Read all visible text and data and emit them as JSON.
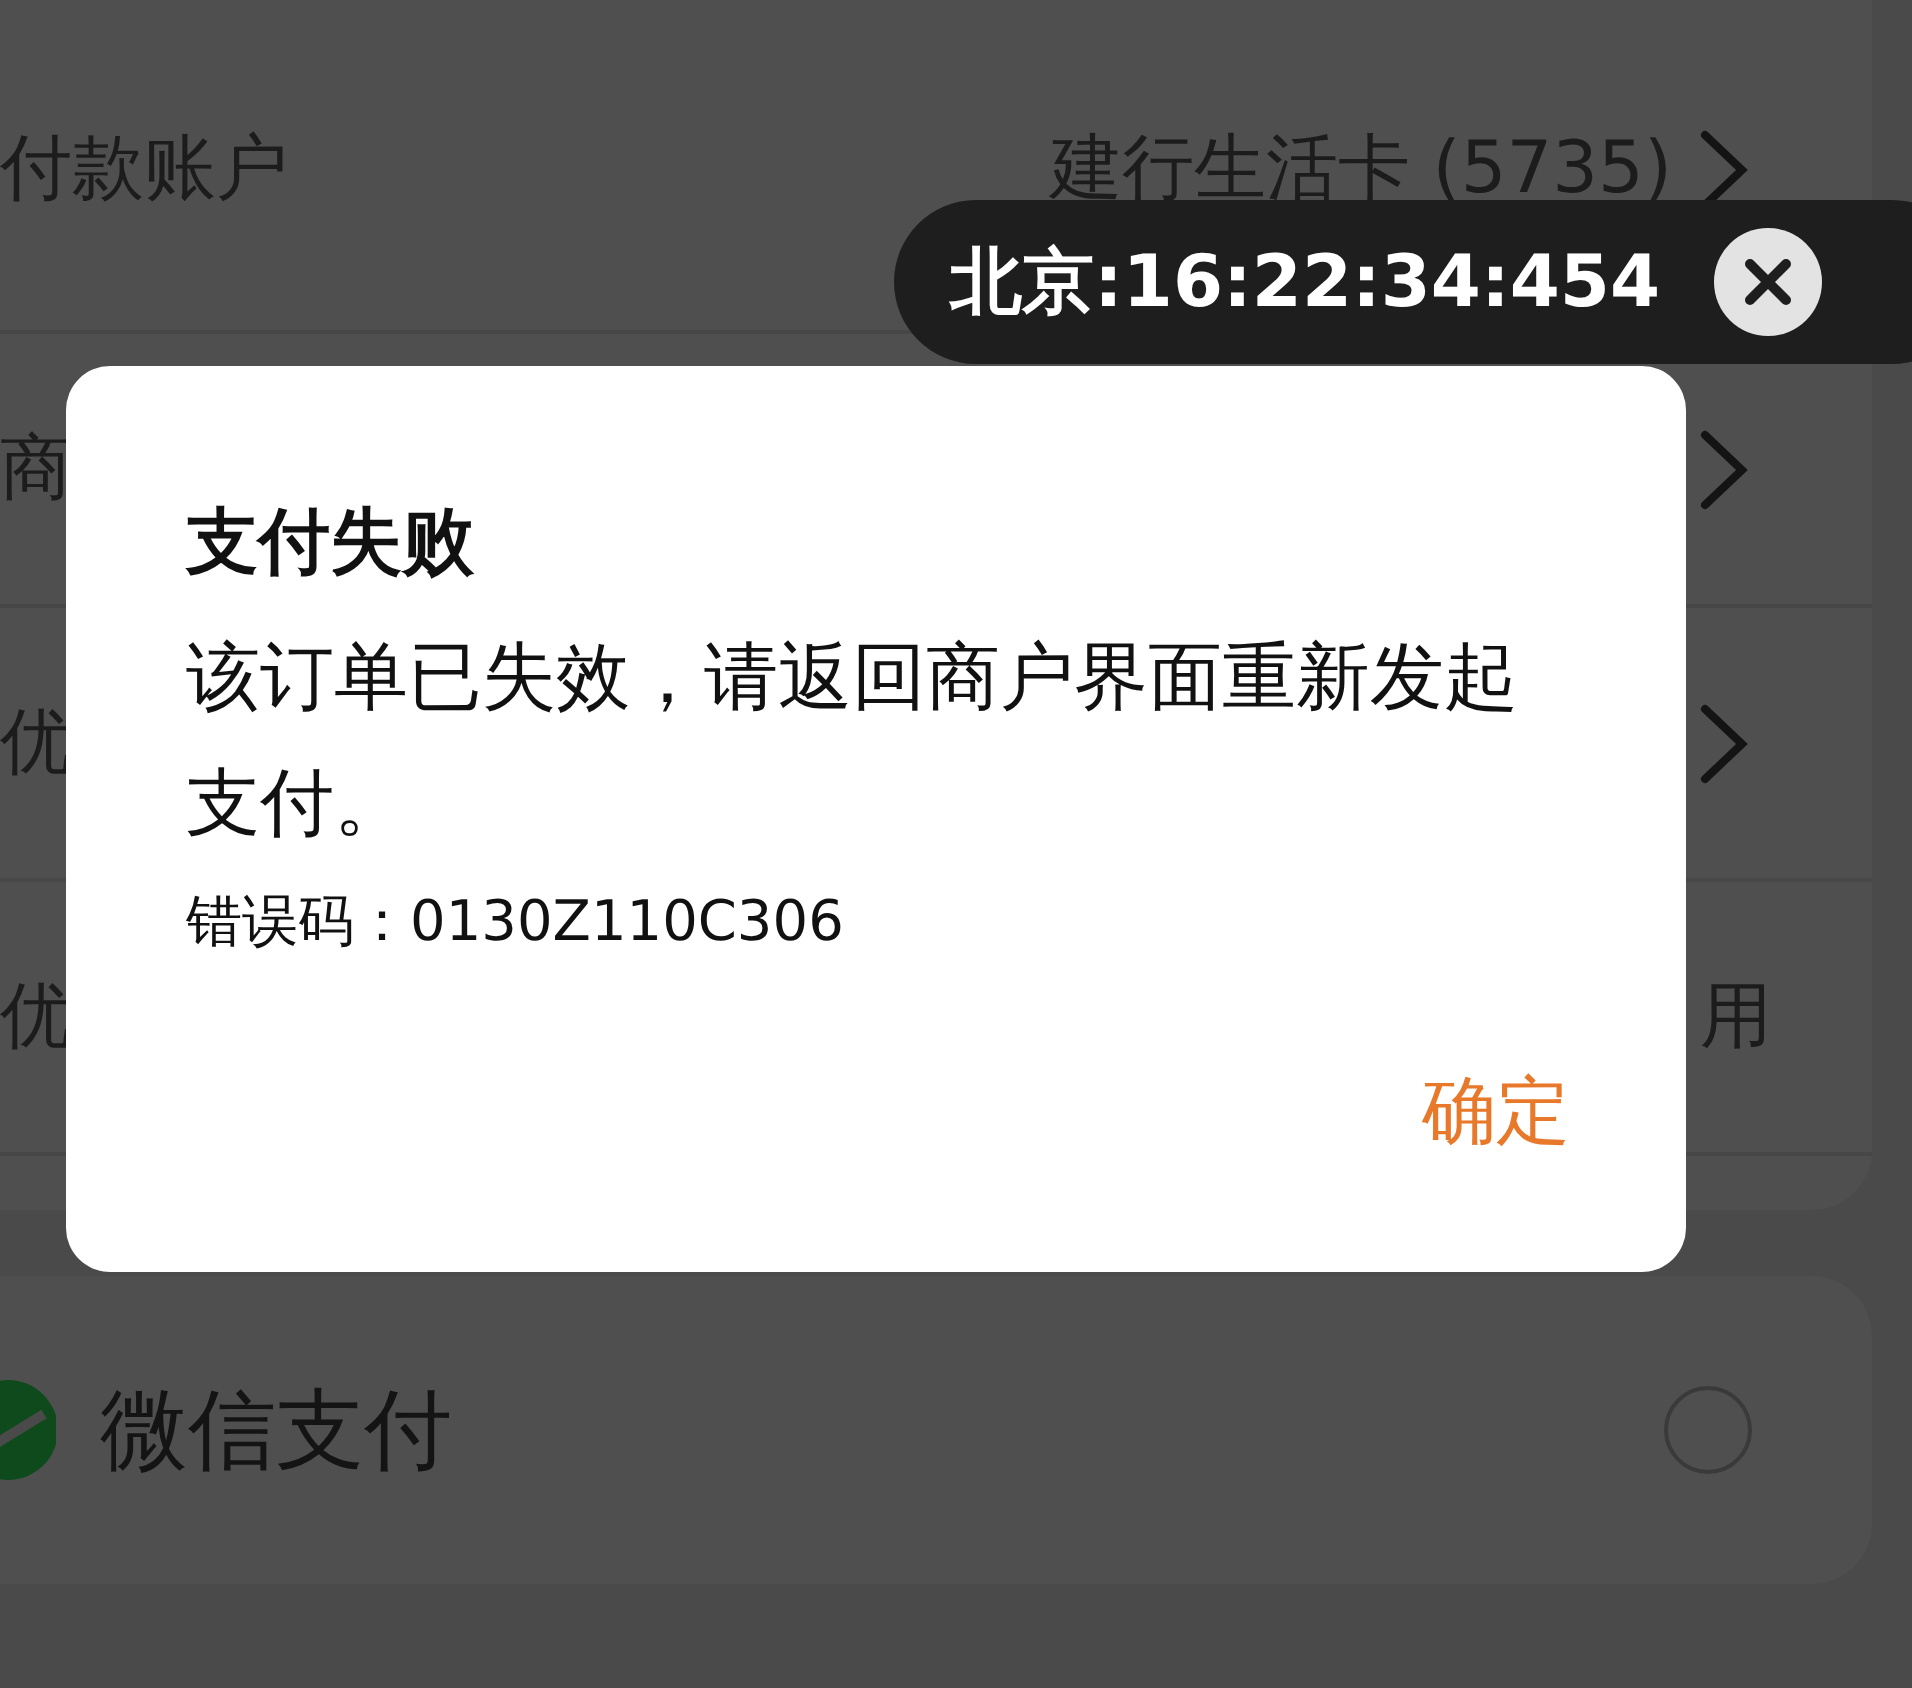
{
  "background": {
    "rows": [
      {
        "label": "付款账户",
        "value": "建行生活卡 (5735)",
        "chevron": true
      },
      {
        "label": "商",
        "chevron": true
      },
      {
        "label": "优",
        "chevron": true
      },
      {
        "label": "优",
        "value": "用",
        "chevron": false
      }
    ],
    "payment_option": {
      "label": "微信支付",
      "selected": false
    }
  },
  "time_overlay": {
    "text": "北京:16:22:34:454"
  },
  "dialog": {
    "title": "支付失败",
    "message": "该订单已失效，请返回商户界面重新发起支付。",
    "error_code": "错误码：0130Z110C306",
    "button": "确定"
  }
}
